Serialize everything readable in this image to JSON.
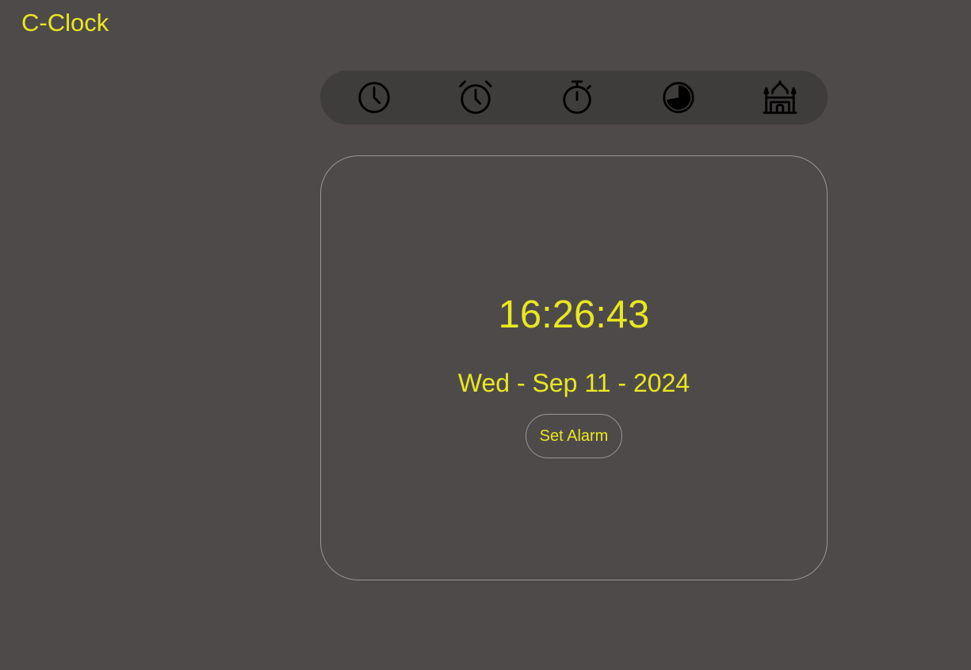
{
  "app": {
    "title": "C-Clock"
  },
  "nav": {
    "items": [
      {
        "icon": "clock-icon"
      },
      {
        "icon": "alarm-clock-icon"
      },
      {
        "icon": "stopwatch-icon"
      },
      {
        "icon": "timer-icon"
      },
      {
        "icon": "mosque-icon"
      }
    ]
  },
  "clock": {
    "time": "16:26:43",
    "date": "Wed - Sep 11 - 2024",
    "set_alarm_label": "Set Alarm"
  },
  "colors": {
    "background": "#4f4a4a",
    "nav_background": "#3f3c3c",
    "accent": "#e8e820",
    "border": "#9a9696",
    "icon": "#000000"
  }
}
